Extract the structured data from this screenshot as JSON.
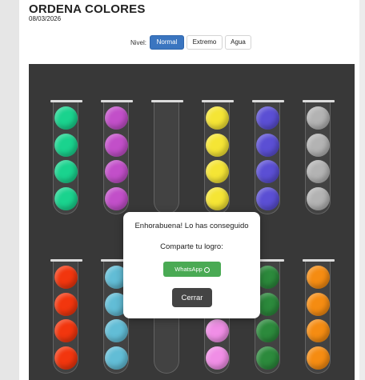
{
  "header": {
    "title": "ORDENA COLORES",
    "date": "08/03/2026"
  },
  "level_selector": {
    "label": "Nivel:",
    "options": [
      "Normal",
      "Extremo",
      "Agua"
    ],
    "selected": "Normal"
  },
  "colors": {
    "green": "#1ad38e",
    "magenta": "#c24fc9",
    "yellow": "#f5e535",
    "blue": "#5b4fd4",
    "gray": "#b3b3b3",
    "red": "#f2360e",
    "light_blue": "#62bdd6",
    "pink": "#f08ee6",
    "dark_green": "#2c8a3c",
    "orange": "#f58c12",
    "active_button": "#3a75c0",
    "board_background": "#383838"
  },
  "board": {
    "tube_capacity": 4,
    "rows": [
      {
        "tubes": [
          [
            "green",
            "green",
            "green",
            "green"
          ],
          [
            "magenta",
            "magenta",
            "magenta",
            "magenta"
          ],
          [],
          [
            "yellow",
            "yellow",
            "yellow",
            "yellow"
          ],
          [
            "blue",
            "blue",
            "blue",
            "blue"
          ],
          [
            "gray",
            "gray",
            "gray",
            "gray"
          ]
        ]
      },
      {
        "tubes": [
          [
            "red",
            "red",
            "red",
            "red"
          ],
          [
            "light_blue",
            "light_blue",
            "light_blue",
            "light_blue"
          ],
          [],
          [
            "pink",
            "pink",
            "pink",
            "pink"
          ],
          [
            "dark_green",
            "dark_green",
            "dark_green",
            "dark_green"
          ],
          [
            "orange",
            "orange",
            "orange",
            "orange"
          ]
        ]
      }
    ]
  },
  "modal": {
    "title": "Enhorabuena! Lo has conseguido",
    "share_text": "Comparte tu logro:",
    "whatsapp_label": "WhatsApp",
    "whatsapp_icon": "whatsapp-icon",
    "close_label": "Cerrar"
  }
}
